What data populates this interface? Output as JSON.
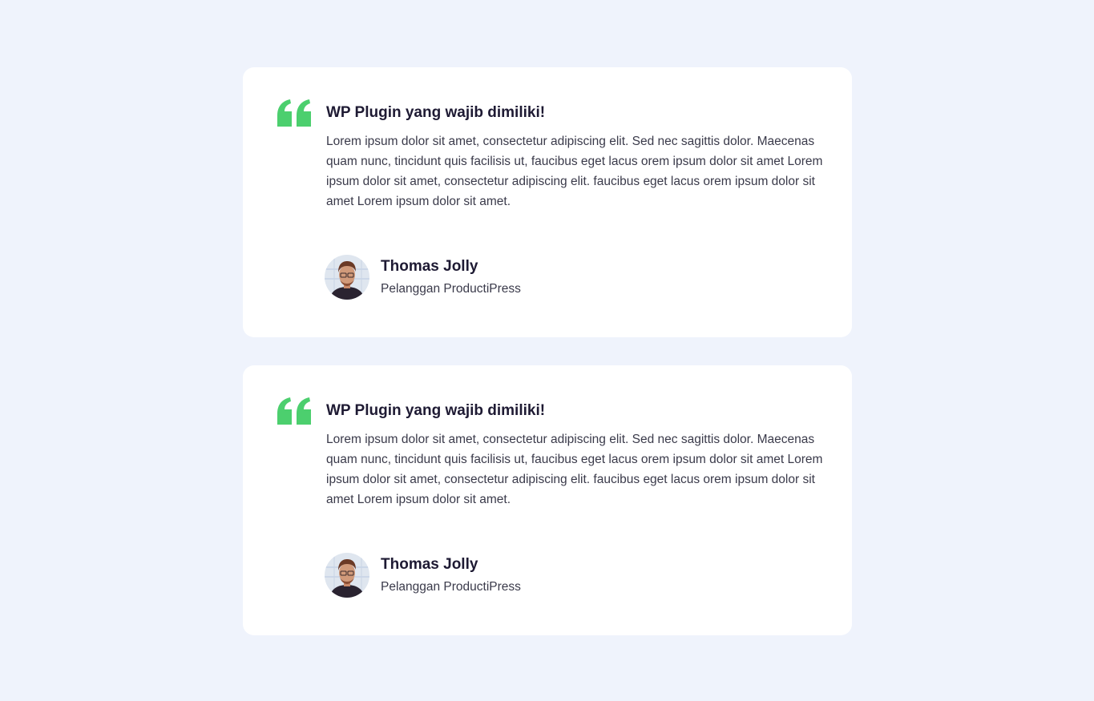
{
  "accent_color": "#4ccf6e",
  "testimonials": [
    {
      "icon": "quote-icon",
      "headline": "WP Plugin yang wajib dimiliki!",
      "body": "Lorem ipsum dolor sit amet, consectetur adipiscing elit. Sed nec sagittis dolor. Maecenas quam nunc, tincidunt quis facilisis ut, faucibus eget lacus orem ipsum dolor sit amet Lorem ipsum dolor sit amet, consectetur adipiscing elit. faucibus eget lacus orem ipsum dolor sit amet Lorem ipsum dolor sit amet.",
      "author_name": "Thomas Jolly",
      "author_role": "Pelanggan ProductiPress"
    },
    {
      "icon": "quote-icon",
      "headline": "WP Plugin yang wajib dimiliki!",
      "body": "Lorem ipsum dolor sit amet, consectetur adipiscing elit. Sed nec sagittis dolor. Maecenas quam nunc, tincidunt quis facilisis ut, faucibus eget lacus orem ipsum dolor sit amet Lorem ipsum dolor sit amet, consectetur adipiscing elit. faucibus eget lacus orem ipsum dolor sit amet Lorem ipsum dolor sit amet.",
      "author_name": "Thomas Jolly",
      "author_role": "Pelanggan ProductiPress"
    }
  ]
}
